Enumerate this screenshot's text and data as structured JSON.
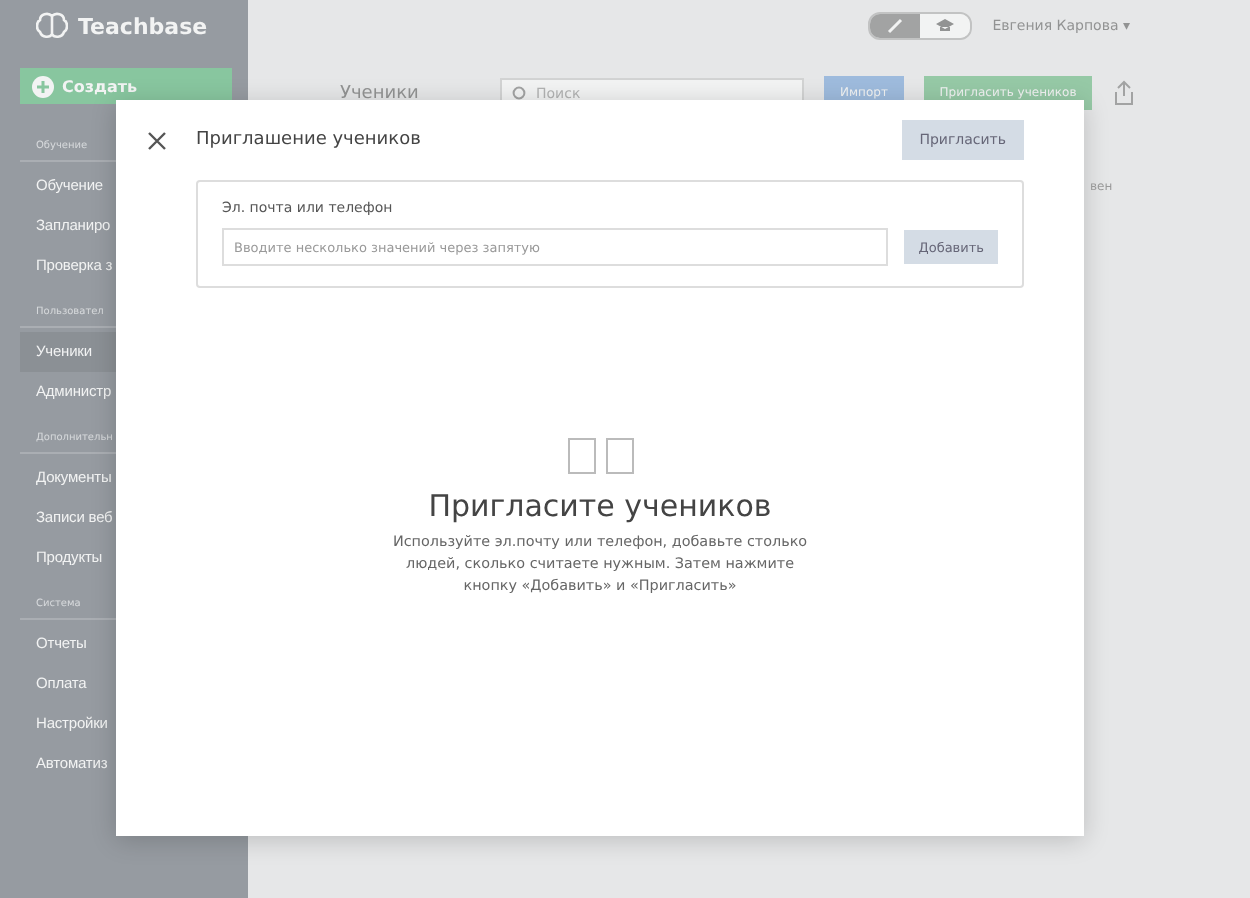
{
  "sidebar": {
    "logo": "Teachbase",
    "create_button": "Создать",
    "sections": [
      {
        "title": "Обучение",
        "items": [
          {
            "label": "Обучение",
            "selected": false
          },
          {
            "label": "Запланиро",
            "selected": false
          },
          {
            "label": "Проверка з",
            "selected": false
          }
        ]
      },
      {
        "title": "Пользовател",
        "items": [
          {
            "label": "Ученики",
            "selected": true
          },
          {
            "label": "Администр",
            "selected": false
          }
        ]
      },
      {
        "title": "Дополнительн",
        "items": [
          {
            "label": "Документы",
            "selected": false
          },
          {
            "label": "Записи веб",
            "selected": false
          },
          {
            "label": "Продукты",
            "selected": false
          }
        ]
      },
      {
        "title": "Система",
        "items": [
          {
            "label": "Отчеты",
            "selected": false
          },
          {
            "label": "Оплата",
            "selected": false
          },
          {
            "label": "Настройки",
            "selected": false
          },
          {
            "label": "Автоматиз",
            "selected": false
          }
        ]
      }
    ]
  },
  "header": {
    "user_name": "Евгения Карпова",
    "caret": "▾"
  },
  "page": {
    "title": "Ученики",
    "search_placeholder": "Поиск",
    "import_button": "Импорт",
    "invite_button": "Пригласить учеников",
    "column_text": "вен"
  },
  "modal": {
    "heading": "Приглашение учеников",
    "invite_button": "Пригласить",
    "field_label": "Эл. почта или телефон",
    "field_placeholder": "Вводите несколько значений через запятую",
    "add_button": "Добавить",
    "empty_title": "Пригласите учеников",
    "empty_text": "Используйте эл.почту или телефон, добавьте столько людей, сколько считаете нужным. Затем нажмите кнопку «Добавить» и «Пригласить»"
  }
}
